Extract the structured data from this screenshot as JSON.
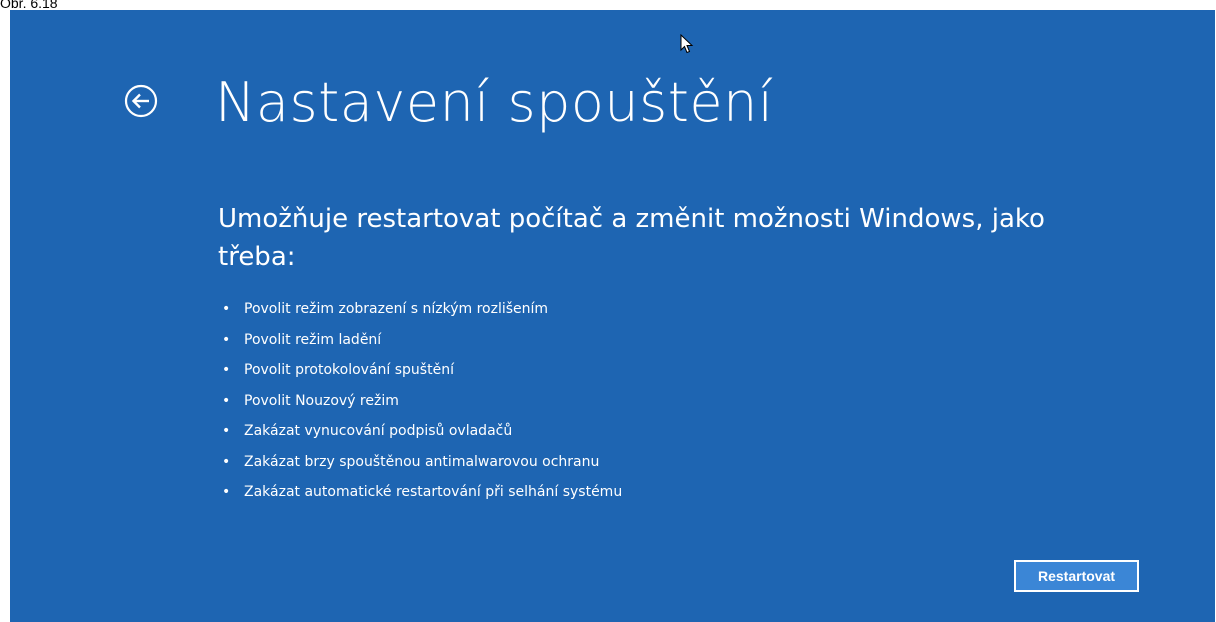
{
  "caption": "Obr. 6.18",
  "screen": {
    "background": "#1e65b2",
    "back_icon": "back-arrow-circle-icon",
    "title": "Nastavení spouštění",
    "subtitle": "Umožňuje restartovat počítač a změnit možnosti Windows, jako třeba:",
    "bullet_glyph": "•",
    "options": [
      "Povolit režim zobrazení s nízkým rozlišením",
      "Povolit režim ladění",
      "Povolit protokolování spuštění",
      "Povolit Nouzový režim",
      "Zakázat vynucování podpisů ovladačů",
      "Zakázat brzy spouštěnou antimalwarovou ochranu",
      "Zakázat automatické restartování při selhání systému"
    ],
    "restart_button": {
      "label": "Restartovat",
      "color": "#3b86d6"
    }
  }
}
